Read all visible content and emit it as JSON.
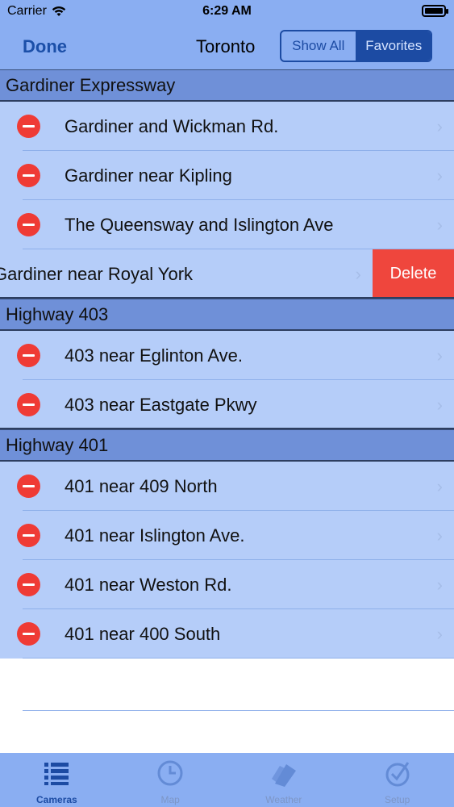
{
  "status_bar": {
    "carrier": "Carrier",
    "time": "6:29 AM",
    "battery_level": 1.0
  },
  "nav": {
    "done_label": "Done",
    "title": "Toronto",
    "segments": [
      "Show All",
      "Favorites"
    ],
    "selected_segment": "Favorites"
  },
  "sections": [
    {
      "title": "Gardiner Expressway",
      "rows": [
        "Gardiner and Wickman Rd.",
        "Gardiner near Kipling",
        "The Queensway and Islington Ave",
        "Gardiner near Royal York"
      ]
    },
    {
      "title": "Highway 403",
      "rows": [
        "403 near Eglinton Ave.",
        "403 near Eastgate Pkwy"
      ]
    },
    {
      "title": "Highway 401",
      "rows": [
        "401 near 409 North",
        "401 near Islington Ave.",
        "401 near Weston Rd.",
        "401 near 400 South"
      ]
    }
  ],
  "swiped_row": {
    "label": "Gardiner near Royal York",
    "delete_label": "Delete"
  },
  "tabs": [
    {
      "label": "Cameras",
      "icon": "list-icon",
      "selected": true
    },
    {
      "label": "Map",
      "icon": "clock-icon",
      "selected": false
    },
    {
      "label": "Weather",
      "icon": "cloud-icon",
      "selected": false
    },
    {
      "label": "Setup",
      "icon": "check-icon",
      "selected": false
    }
  ],
  "colors": {
    "accent": "#1c4ba3",
    "delete": "#ef463d",
    "row_bg": "#b5cdf9",
    "header_bg": "#6f90d8"
  }
}
